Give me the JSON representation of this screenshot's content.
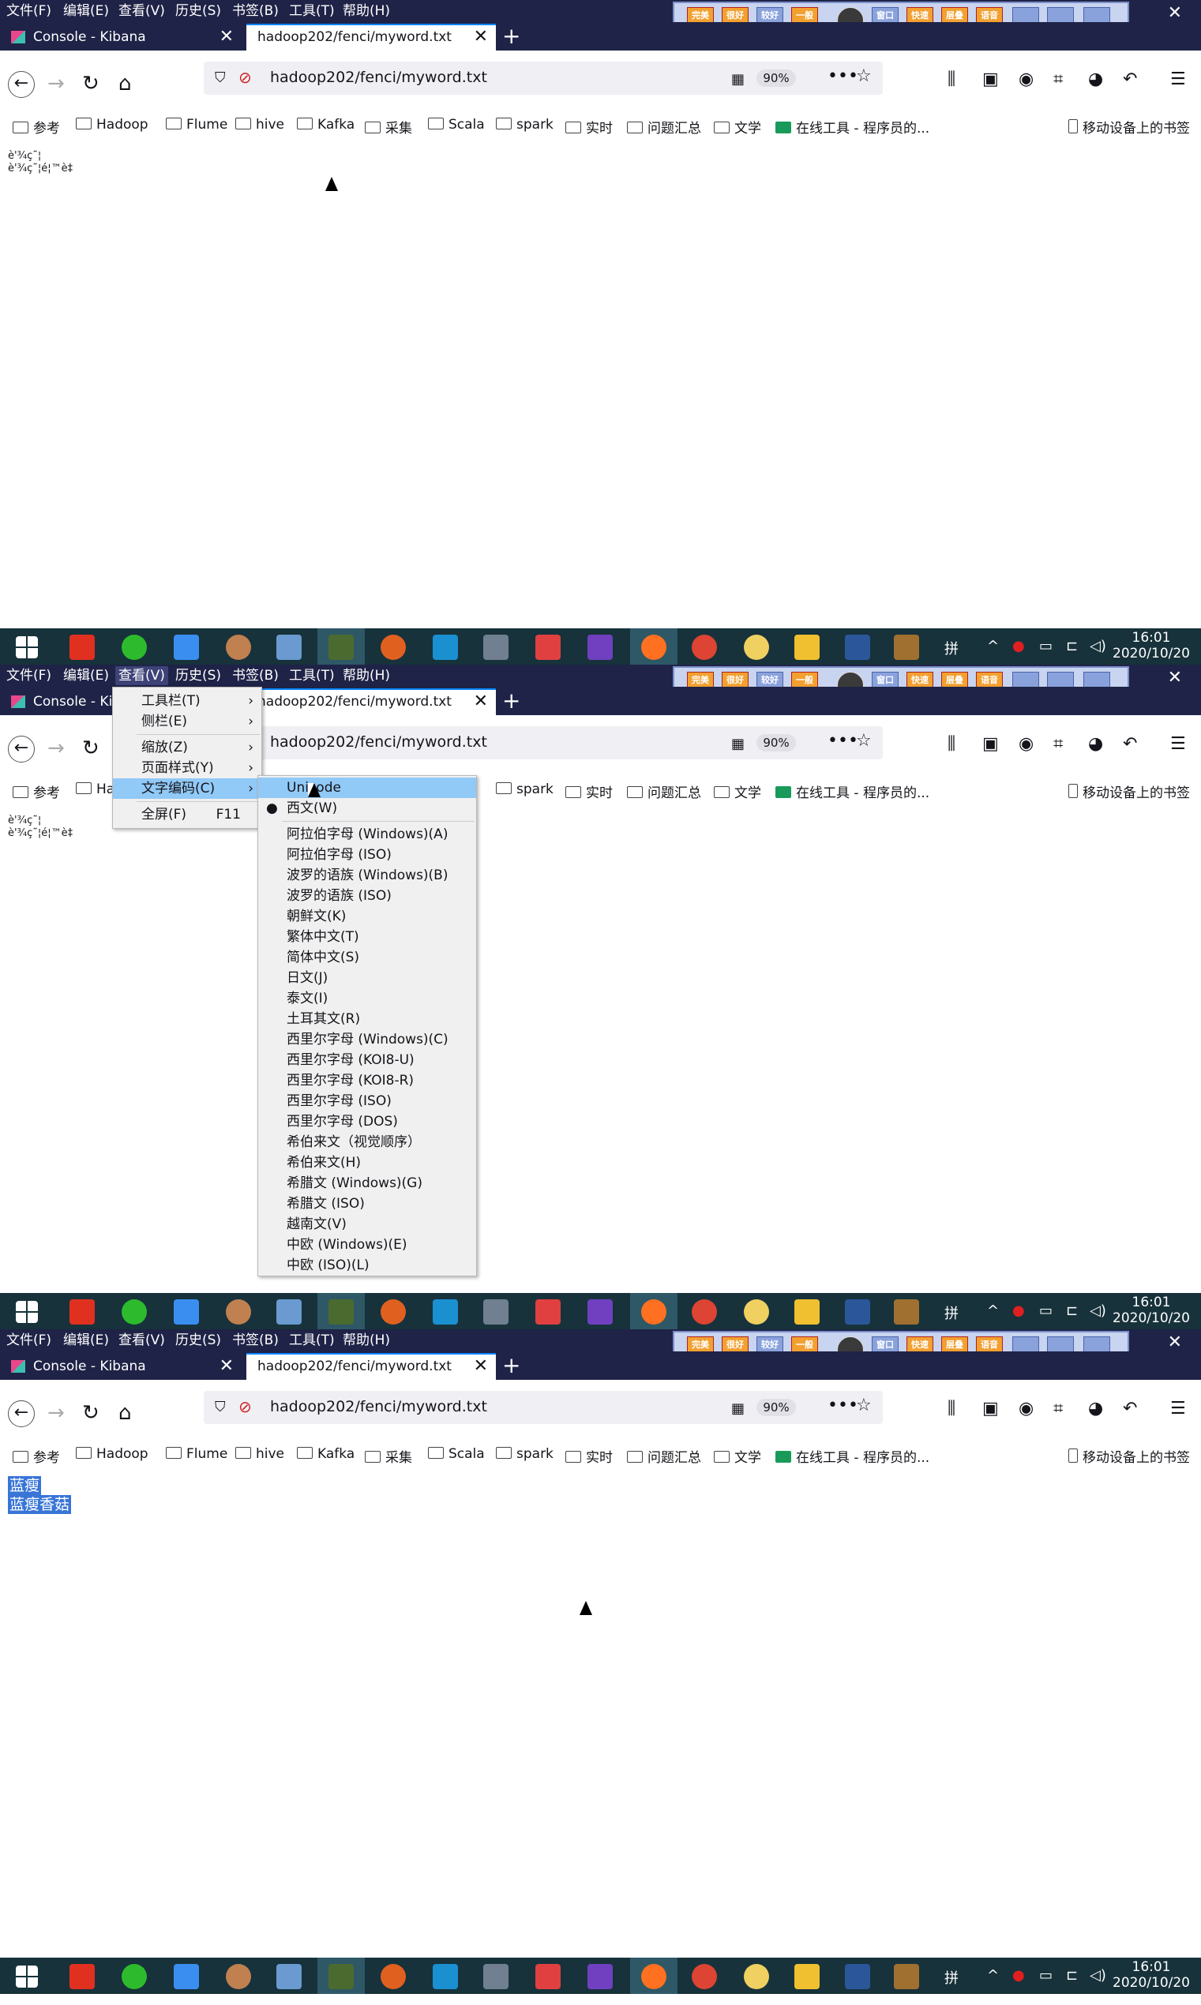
{
  "menubar": [
    "文件(F)",
    "编辑(E)",
    "查看(V)",
    "历史(S)",
    "书签(B)",
    "工具(T)",
    "帮助(H)"
  ],
  "tabs": {
    "kibana": "Console - Kibana",
    "file": "hadoop202/fenci/myword.txt",
    "close": "✕",
    "new": "+"
  },
  "window_close": "✕",
  "ime_buttons": [
    "完美画质",
    "很好画质",
    "较好画质",
    "一般画质",
    "",
    "窗口模式",
    "快速高效",
    "层叠窗口",
    "语音广播"
  ],
  "url": "hadoop202/fenci/myword.txt",
  "zoom": "90%",
  "bookmarks": [
    "参考",
    "Hadoop",
    "Flume",
    "hive",
    "Kafka",
    "采集",
    "Scala",
    "spark",
    "实时",
    "问题汇总",
    "文学",
    "在线工具 - 程序员的...",
    "移动设备上的书签"
  ],
  "garbled_text": "è'¾ç˜¦\nè'¾ç˜¦é¦™è‡",
  "decoded_text": {
    "line1": "蓝瘦",
    "line2": "蓝瘦香菇"
  },
  "view_menu": [
    "工具栏(T)",
    "侧栏(E)",
    "缩放(Z)",
    "页面样式(Y)",
    "文字编码(C)",
    "全屏(F)"
  ],
  "fullscreen_key": "F11",
  "encoding_menu": [
    "Unicode",
    "西文(W)",
    "阿拉伯字母 (Windows)(A)",
    "阿拉伯字母 (ISO)",
    "波罗的语族 (Windows)(B)",
    "波罗的语族 (ISO)",
    "朝鲜文(K)",
    "繁体中文(T)",
    "简体中文(S)",
    "日文(J)",
    "泰文(I)",
    "土耳其文(R)",
    "西里尔字母 (Windows)(C)",
    "西里尔字母 (KOI8-U)",
    "西里尔字母 (KOI8-R)",
    "西里尔字母 (ISO)",
    "西里尔字母 (DOS)",
    "希伯来文（视觉顺序）",
    "希伯来文(H)",
    "希腊文 (Windows)(G)",
    "希腊文 (ISO)",
    "越南文(V)",
    "中欧 (Windows)(E)",
    "中欧 (ISO)(L)"
  ],
  "clock": {
    "time": "16:01",
    "date": "2020/10/20"
  },
  "tray_ime": "拼",
  "colors": {
    "titlebar": "#1f2347",
    "taskbar": "#17323b",
    "selection": "#3875d7",
    "menu_highlight": "#91c9f7"
  }
}
